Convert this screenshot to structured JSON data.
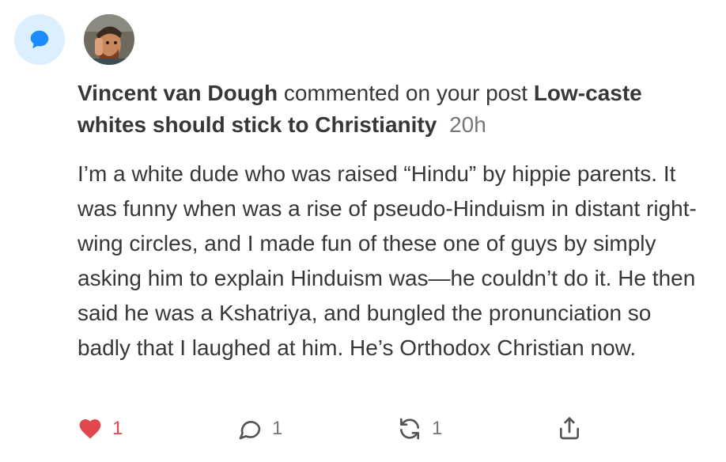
{
  "notification": {
    "type_icon": "speech-bubble-icon",
    "colors": {
      "badge_bg": "#dcefff",
      "badge_icon": "#1a8cff",
      "like": "#e0484d"
    },
    "author": "Vincent van Dough",
    "action_text": "commented on your post",
    "post_title": "Low-caste whites should stick to Christianity",
    "time": "20h",
    "comment_text": "I’m a white dude who was raised “Hindu” by hippie parents. It was funny when was a rise of pseudo-Hinduism in distant right-wing circles, and I made fun of these one of guys by simply asking him to explain Hinduism was—he couldn’t do it. He then said he was a Kshatriya, and bungled the pronunciation so badly that I laughed at him. He’s Orthodox Christian now."
  },
  "actions": {
    "like": {
      "icon": "heart-icon",
      "count": "1"
    },
    "comment": {
      "icon": "comment-icon",
      "count": "1"
    },
    "restack": {
      "icon": "restack-icon",
      "count": "1"
    },
    "share": {
      "icon": "share-icon"
    }
  }
}
